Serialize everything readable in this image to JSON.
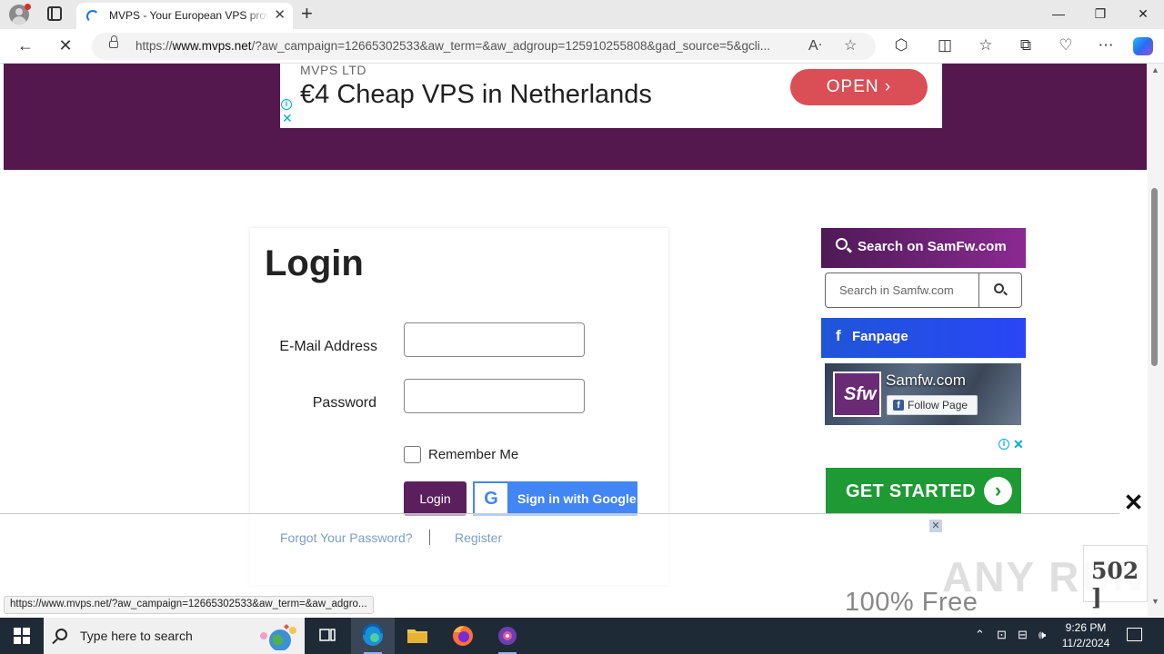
{
  "browser": {
    "tab_title": "MVPS - Your European VPS provider",
    "tab_close": "✕",
    "new_tab": "+",
    "window_controls": {
      "minimize": "—",
      "maximize": "❐",
      "close": "✕"
    },
    "url_prefix": "https://",
    "url_host": "www.mvps.net",
    "url_rest": "/?aw_campaign=12665302533&aw_term=&aw_adgroup=125910255808&gad_source=5&gcli...",
    "status_url": "https://www.mvps.net/?aw_campaign=12665302533&aw_term=&aw_adgro..."
  },
  "top_ad": {
    "advertiser": "MVPS LTD",
    "headline": "€4 Cheap VPS in Netherlands",
    "cta": "OPEN ›",
    "info": "i",
    "close": "✕"
  },
  "login": {
    "title": "Login",
    "email_label": "E-Mail Address",
    "email_value": "",
    "password_label": "Password",
    "password_value": "",
    "remember_label": "Remember Me",
    "remember_checked": false,
    "login_button": "Login",
    "google_button": "Sign in with Google",
    "google_glyph": "G",
    "forgot_link": "Forgot Your Password?",
    "register_link": "Register"
  },
  "sidebar": {
    "search_title": "Search on SamFw.com",
    "search_placeholder": "Search in Samfw.com",
    "fanpage_title": "Fanpage",
    "fb_letter": "f",
    "fb_page_name": "Samfw.com",
    "fb_logo_text": "Sfw",
    "fb_follow": "Follow Page"
  },
  "side_ad": {
    "info": "i",
    "close": "✕",
    "cta": "GET STARTED",
    "arrow": "›",
    "small_close": "✕",
    "tagline": "100% Free"
  },
  "overlay": {
    "close": "✕"
  },
  "error_badge": "502 ]",
  "watermark": "ANY RUN",
  "taskbar": {
    "search_placeholder": "Type here to search",
    "time": "9:26 PM",
    "date": "11/2/2024"
  },
  "colors": {
    "brand_purple": "#54184f",
    "login_button": "#5b1f5e",
    "google_blue": "#4285f4",
    "ad_open": "#d94f55",
    "get_started": "#1e9a35",
    "link": "#7d9ec4"
  }
}
